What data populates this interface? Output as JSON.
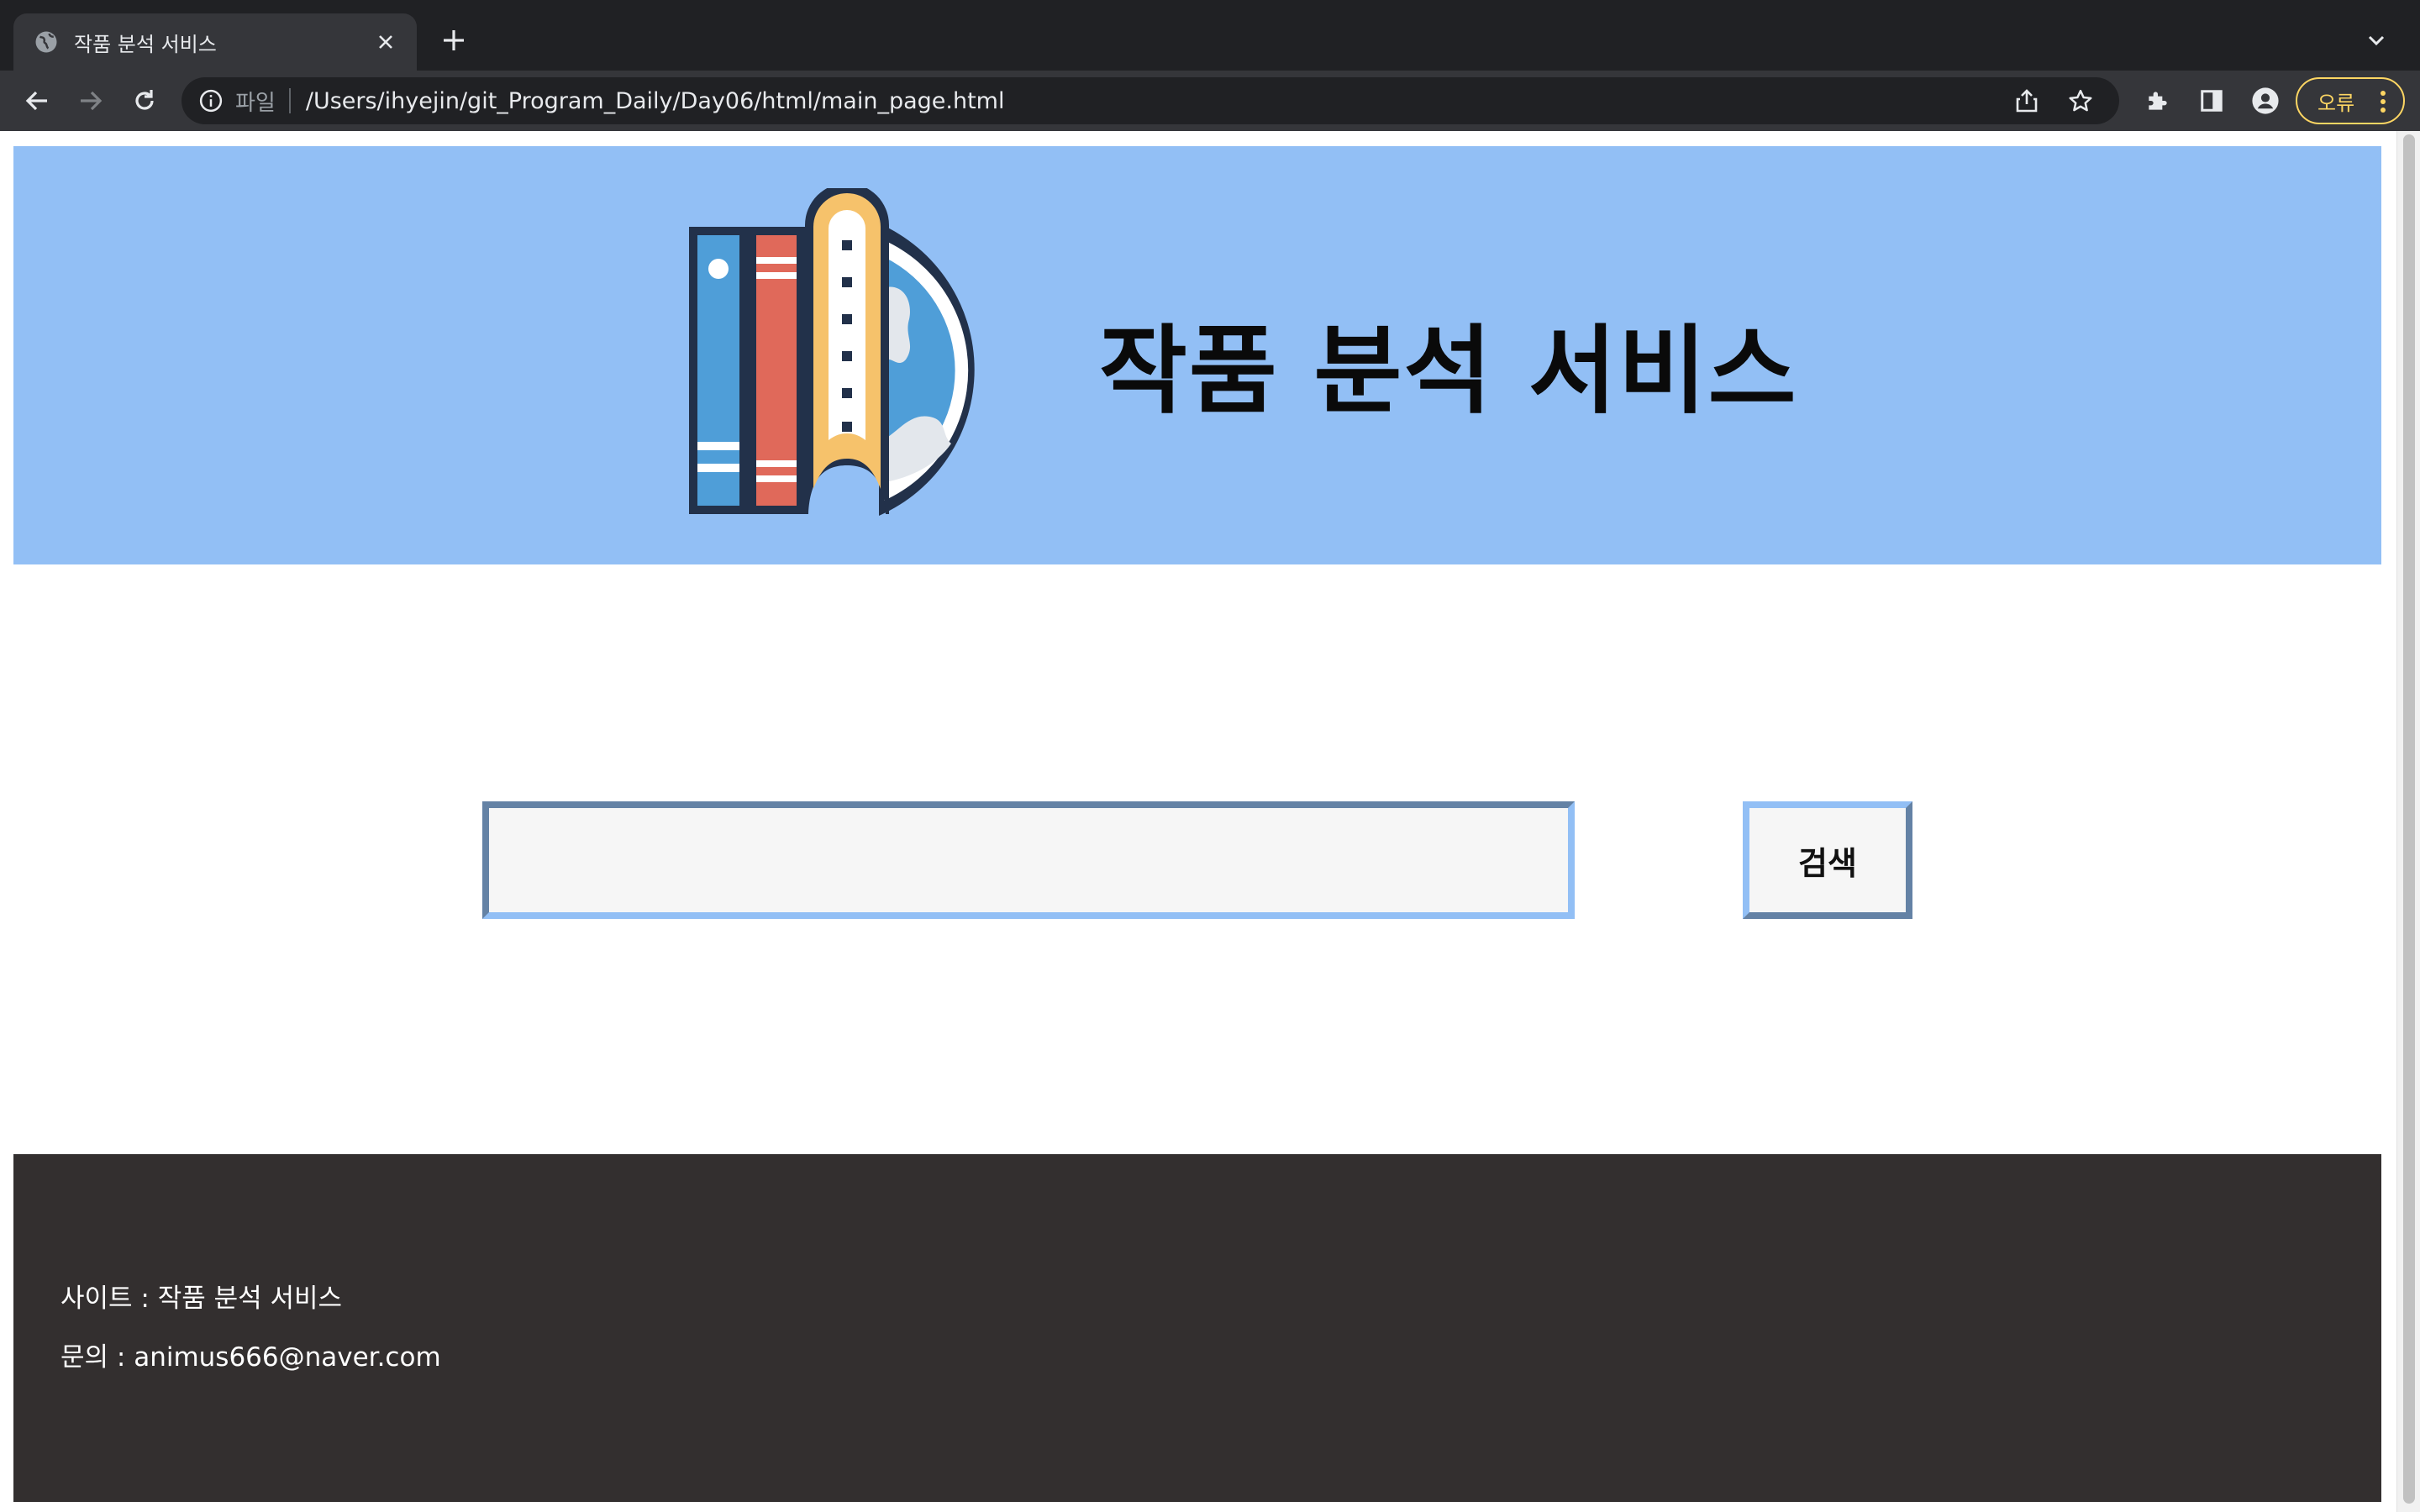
{
  "browser": {
    "tab_title": "작품 분석 서비스",
    "omnibox_scheme": "파일",
    "url": "/Users/ihyejin/git_Program_Daily/Day06/html/main_page.html",
    "error_label": "오류"
  },
  "page": {
    "title": "작품 분석 서비스",
    "search": {
      "value": "",
      "placeholder": "",
      "button_label": "검색"
    },
    "footer": {
      "site_line": "사이트 : 작품 분석 서비스",
      "contact_line": "문의 : animus666@naver.com"
    }
  },
  "colors": {
    "header_background": "#92bff5",
    "footer_background": "#332f2f",
    "chrome_dark": "#202124",
    "chrome_toolbar": "#35363a",
    "error_accent": "#fdd663"
  }
}
